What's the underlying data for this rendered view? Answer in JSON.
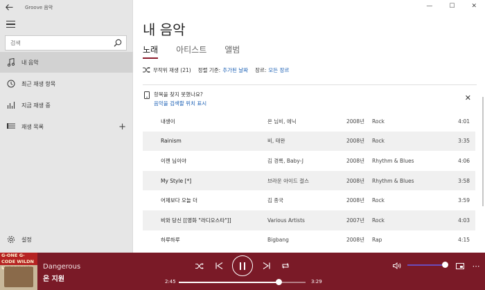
{
  "app": {
    "title": "Groove 음악"
  },
  "sidebar": {
    "search_placeholder": "검색",
    "items": [
      {
        "label": "내 음악",
        "icon": "music-note-icon",
        "active": true
      },
      {
        "label": "최근 재생 항목",
        "icon": "clock-icon"
      },
      {
        "label": "지금 재생 중",
        "icon": "bars-icon"
      },
      {
        "label": "재생 목록",
        "icon": "playlist-icon"
      }
    ],
    "settings_label": "설정"
  },
  "main": {
    "title": "내 음악",
    "tabs": [
      {
        "label": "노래",
        "active": true
      },
      {
        "label": "아티스트"
      },
      {
        "label": "앨범"
      }
    ],
    "toolbar": {
      "shuffle_label": "무작위 재생 (21)",
      "sort_prefix": "정렬 기준:",
      "sort_value": "추가된 날짜",
      "genre_prefix": "장르:",
      "genre_value": "모든 장르"
    },
    "notice": {
      "title": "항목을 찾지 못했나요?",
      "link": "음악을 검색할 위치 표시"
    },
    "songs": [
      {
        "title": "내생이",
        "artist": "온 님비, 에닉",
        "year": "2008년",
        "genre": "Rock",
        "duration": "4:01"
      },
      {
        "title": "Rainism",
        "artist": "비, 태완",
        "year": "2008년",
        "genre": "Rock",
        "duration": "3:35"
      },
      {
        "title": "이젠 님이야",
        "artist": "김 경록, Baby-J",
        "year": "2008년",
        "genre": "Rhythm & Blues",
        "duration": "4:06"
      },
      {
        "title": "My Style [*]",
        "artist": "브라운 아이드 걸스",
        "year": "2008년",
        "genre": "Rhythm & Blues",
        "duration": "3:58"
      },
      {
        "title": "어제보다 오늘 더",
        "artist": "김 종국",
        "year": "2008년",
        "genre": "Rock",
        "duration": "3:59"
      },
      {
        "title": "비와 당신 [[영화 \"라디오스타\"]]",
        "artist": "Various Artists",
        "year": "2007년",
        "genre": "Rock",
        "duration": "4:03"
      },
      {
        "title": "하루하루",
        "artist": "Bigbang",
        "year": "2008년",
        "genre": "Rap",
        "duration": "4:15"
      }
    ]
  },
  "player": {
    "album_text": "G-ONE G-CODE WILDN UN RESERVE",
    "song_title": "Dangerous",
    "artist": "온 지원",
    "elapsed": "2:45",
    "total": "3:29",
    "progress_fraction": 0.79,
    "volume_fraction": 1.0,
    "accent_color": "#7a1a27"
  }
}
